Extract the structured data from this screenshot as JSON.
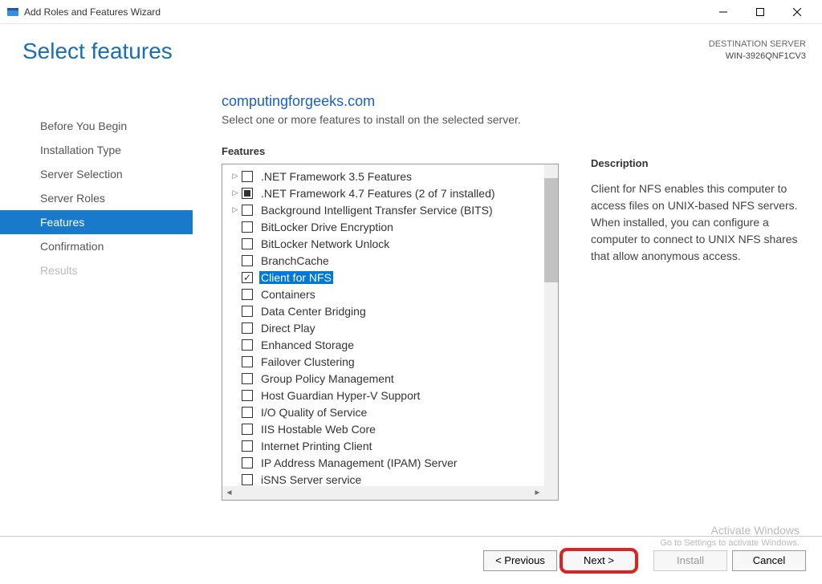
{
  "window": {
    "title": "Add Roles and Features Wizard"
  },
  "header": {
    "pageTitle": "Select features",
    "destLabel": "DESTINATION SERVER",
    "destName": "WIN-3926QNF1CV3"
  },
  "sidebar": {
    "items": [
      {
        "label": "Before You Begin",
        "state": "normal"
      },
      {
        "label": "Installation Type",
        "state": "normal"
      },
      {
        "label": "Server Selection",
        "state": "normal"
      },
      {
        "label": "Server Roles",
        "state": "normal"
      },
      {
        "label": "Features",
        "state": "active"
      },
      {
        "label": "Confirmation",
        "state": "normal"
      },
      {
        "label": "Results",
        "state": "disabled"
      }
    ]
  },
  "main": {
    "watermark": "computingforgeeks.com",
    "instruction": "Select one or more features to install on the selected server.",
    "featuresLabel": "Features",
    "features": [
      {
        "label": ".NET Framework 3.5 Features",
        "expandable": true,
        "check": "none",
        "selected": false
      },
      {
        "label": ".NET Framework 4.7 Features (2 of 7 installed)",
        "expandable": true,
        "check": "partial",
        "selected": false
      },
      {
        "label": "Background Intelligent Transfer Service (BITS)",
        "expandable": true,
        "check": "none",
        "selected": false
      },
      {
        "label": "BitLocker Drive Encryption",
        "expandable": false,
        "check": "none",
        "selected": false
      },
      {
        "label": "BitLocker Network Unlock",
        "expandable": false,
        "check": "none",
        "selected": false
      },
      {
        "label": "BranchCache",
        "expandable": false,
        "check": "none",
        "selected": false
      },
      {
        "label": "Client for NFS",
        "expandable": false,
        "check": "checked",
        "selected": true
      },
      {
        "label": "Containers",
        "expandable": false,
        "check": "none",
        "selected": false
      },
      {
        "label": "Data Center Bridging",
        "expandable": false,
        "check": "none",
        "selected": false
      },
      {
        "label": "Direct Play",
        "expandable": false,
        "check": "none",
        "selected": false
      },
      {
        "label": "Enhanced Storage",
        "expandable": false,
        "check": "none",
        "selected": false
      },
      {
        "label": "Failover Clustering",
        "expandable": false,
        "check": "none",
        "selected": false
      },
      {
        "label": "Group Policy Management",
        "expandable": false,
        "check": "none",
        "selected": false
      },
      {
        "label": "Host Guardian Hyper-V Support",
        "expandable": false,
        "check": "none",
        "selected": false
      },
      {
        "label": "I/O Quality of Service",
        "expandable": false,
        "check": "none",
        "selected": false
      },
      {
        "label": "IIS Hostable Web Core",
        "expandable": false,
        "check": "none",
        "selected": false
      },
      {
        "label": "Internet Printing Client",
        "expandable": false,
        "check": "none",
        "selected": false
      },
      {
        "label": "IP Address Management (IPAM) Server",
        "expandable": false,
        "check": "none",
        "selected": false
      },
      {
        "label": "iSNS Server service",
        "expandable": false,
        "check": "none",
        "selected": false
      }
    ],
    "descLabel": "Description",
    "descText": "Client for NFS enables this computer to access files on UNIX-based NFS servers. When installed, you can configure a computer to connect to UNIX NFS shares that allow anonymous access."
  },
  "footer": {
    "previous": "< Previous",
    "next": "Next >",
    "install": "Install",
    "cancel": "Cancel"
  },
  "activate": {
    "line1": "Activate Windows",
    "line2": "Go to Settings to activate Windows."
  }
}
